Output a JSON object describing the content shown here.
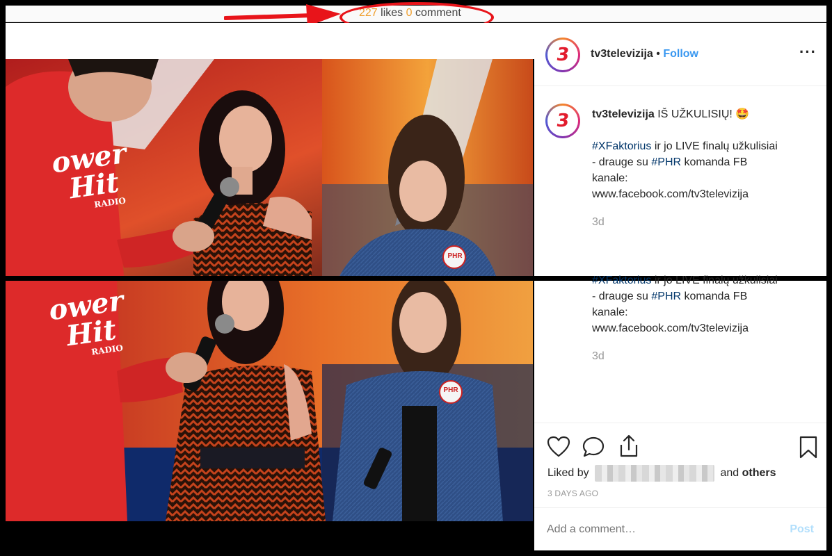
{
  "stats": {
    "likes_count": "227",
    "likes_label": "likes",
    "comments_count": "0",
    "comments_label": "comment"
  },
  "account": {
    "username": "tv3televizija",
    "separator": "•",
    "follow_label": "Follow",
    "more_label": "···",
    "logo_glyph": "3"
  },
  "caption": {
    "username": "tv3televizija",
    "line1": "IŠ UŽKULISIŲ! 🤩",
    "tag1": "#XFaktorius",
    "text1": " ir jo LIVE finalų užkulisiai",
    "text2": "- drauge su ",
    "tag2": "#PHR",
    "text3": " komanda FB",
    "text4": "kanale:",
    "link": "www.facebook.com/tv3televizija",
    "partial_line": "#XFaktorius ir jo LIVE finalų užkulisiai",
    "time": "3d"
  },
  "engagement": {
    "liked_by_prefix": "Liked by",
    "and_label": "and",
    "others_label": "others",
    "date": "3 DAYS AGO"
  },
  "comment": {
    "placeholder": "Add a comment…",
    "post_label": "Post"
  },
  "photo_badges": {
    "hoodie_line1": "ower",
    "hoodie_line2": "Hit",
    "hoodie_line3": "RADIO",
    "pin": "PHR"
  },
  "colors": {
    "accent": "#3897f0",
    "annotation_red": "#e8141a",
    "stat_number": "#f0a030",
    "brand_red": "#e21c2d"
  }
}
